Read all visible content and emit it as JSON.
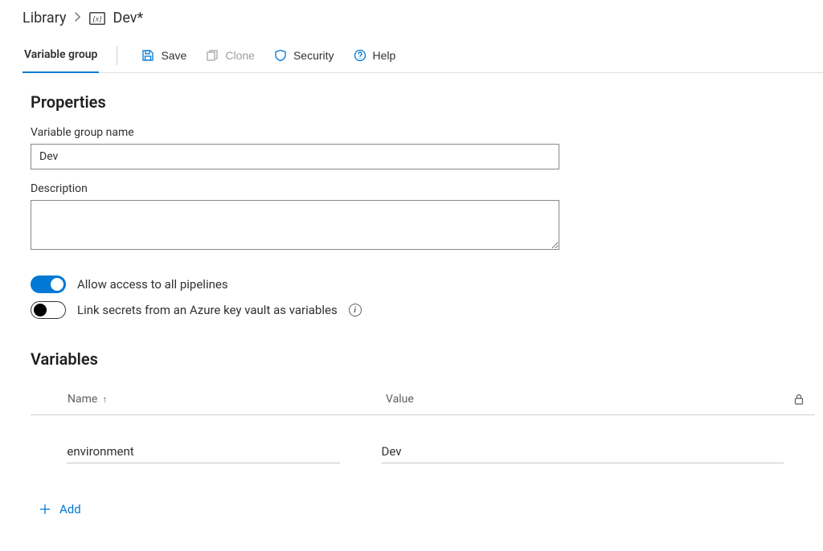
{
  "breadcrumb": {
    "root": "Library",
    "current": "Dev*"
  },
  "tabs": {
    "active": "Variable group"
  },
  "toolbar": {
    "save": "Save",
    "clone": "Clone",
    "security": "Security",
    "help": "Help"
  },
  "properties": {
    "heading": "Properties",
    "name_label": "Variable group name",
    "name_value": "Dev",
    "description_label": "Description",
    "description_value": ""
  },
  "toggles": {
    "allow_access": {
      "label": "Allow access to all pipelines",
      "on": true
    },
    "link_secrets": {
      "label": "Link secrets from an Azure key vault as variables",
      "on": false
    }
  },
  "variables": {
    "heading": "Variables",
    "columns": {
      "name": "Name",
      "value": "Value"
    },
    "rows": [
      {
        "name": "environment",
        "value": "Dev"
      }
    ],
    "add_label": "Add"
  }
}
